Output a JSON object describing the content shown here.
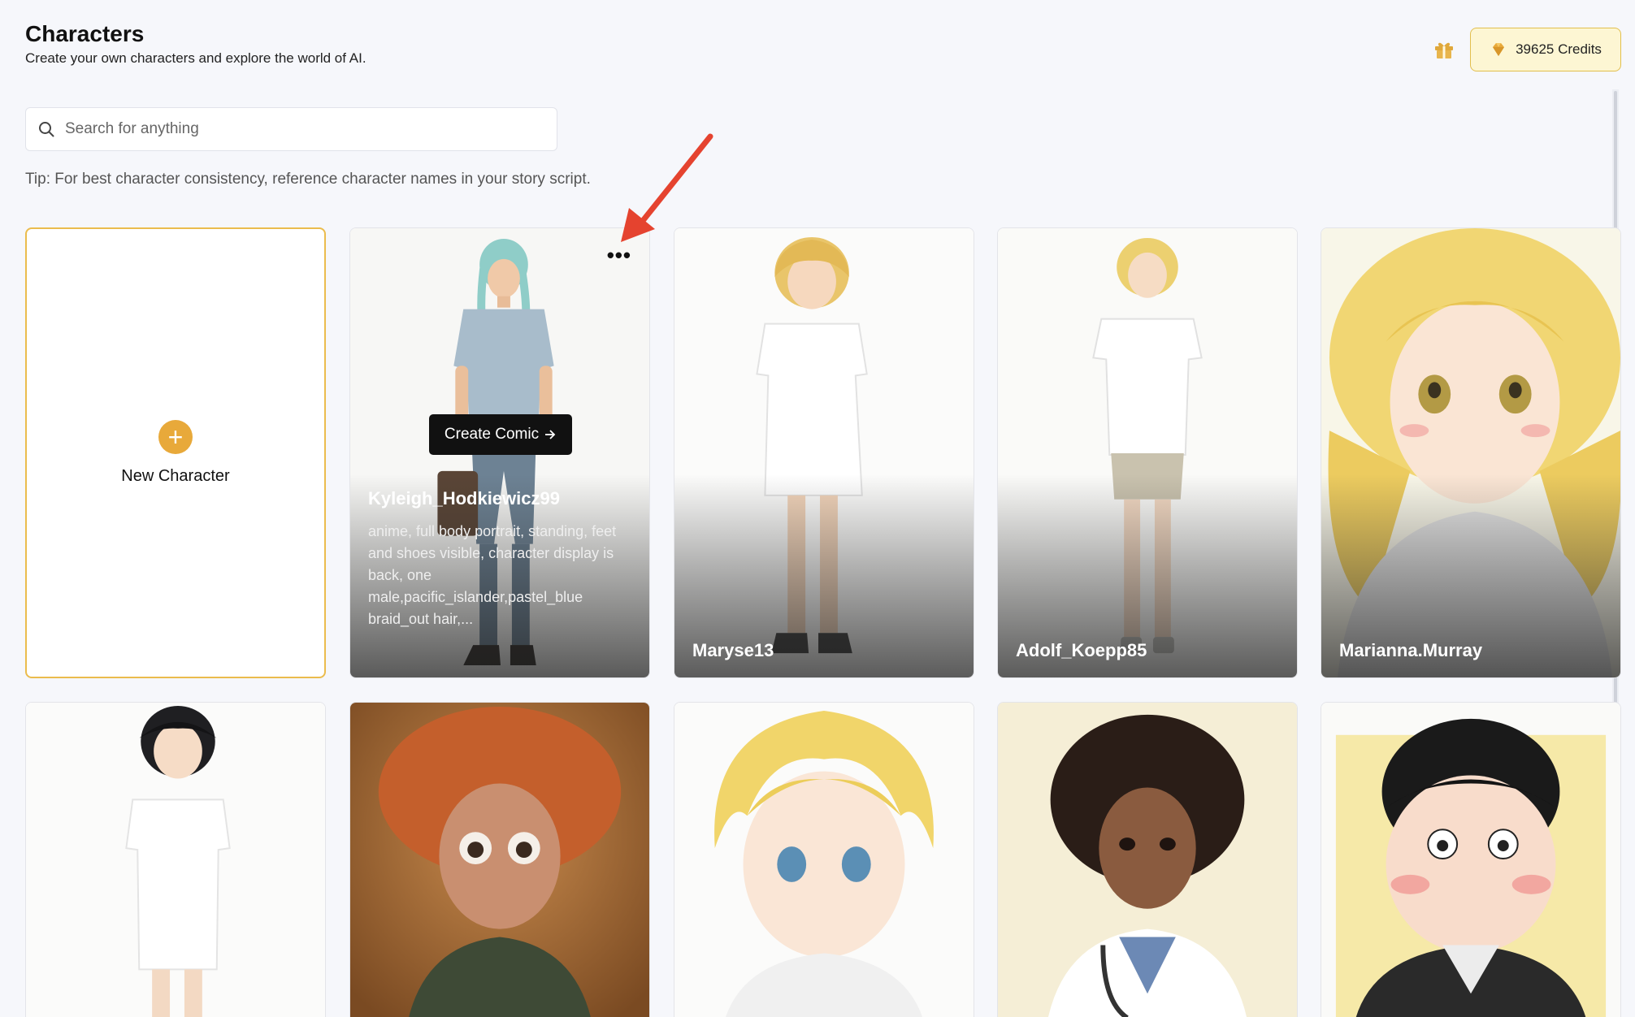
{
  "header": {
    "title": "Characters",
    "subtitle": "Create your own characters and explore the world of AI."
  },
  "credits": {
    "label": "39625 Credits"
  },
  "search": {
    "placeholder": "Search for anything"
  },
  "tip": "Tip: For best character consistency, reference character names in your story script.",
  "new_character": {
    "label": "New Character"
  },
  "hover_card": {
    "name": "Kyleigh_Hodkiewicz99",
    "description": "anime, full body portrait, standing, feet and shoes visible, character display is back, one male,pacific_islander,pastel_blue braid_out hair,...",
    "create_comic_label": "Create Comic",
    "more_label": "•••"
  },
  "characters_row1": [
    {
      "name": "Maryse13"
    },
    {
      "name": "Adolf_Koepp85"
    },
    {
      "name": "Marianna.Murray"
    }
  ],
  "colors": {
    "accent": "#e8a93a",
    "credits_bg": "#fdf6d3",
    "credits_border": "#e2bf4d",
    "annotation_arrow": "#e5432f"
  }
}
